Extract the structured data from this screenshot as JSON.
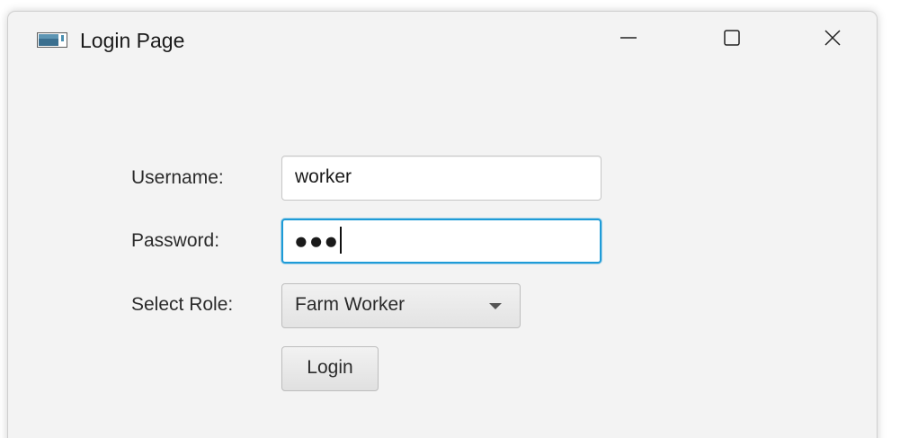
{
  "window": {
    "title": "Login Page",
    "icon": "java-app-icon",
    "controls": {
      "minimize_icon": "minimize-icon",
      "maximize_icon": "maximize-icon",
      "close_icon": "close-icon"
    }
  },
  "form": {
    "username": {
      "label": "Username:",
      "value": "worker"
    },
    "password": {
      "label": "Password:",
      "masked_value": "●●●"
    },
    "role": {
      "label": "Select Role:",
      "selected": "Farm Worker"
    },
    "login_button_label": "Login"
  },
  "colors": {
    "focus_accent": "#1e9bd7",
    "window_background": "#f3f3f3"
  }
}
